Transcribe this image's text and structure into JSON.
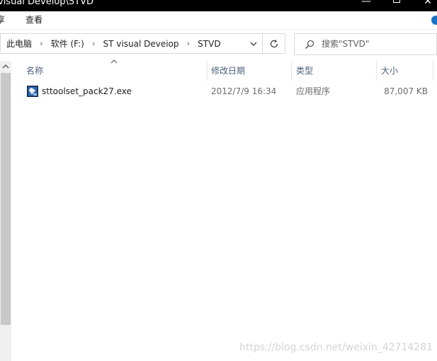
{
  "window": {
    "title": "visual Develop\\STVD",
    "controls": {
      "minimize_icon": "minimize-icon",
      "maximize_icon": "maximize-icon",
      "close_icon": "close-icon"
    }
  },
  "ribbon": {
    "tabs": [
      {
        "label": "享"
      },
      {
        "label": "查看"
      }
    ],
    "help_icon": "help-icon"
  },
  "address": {
    "crumbs": [
      "此电脑",
      "软件 (F:)",
      "ST visual Deveiop",
      "STVD"
    ],
    "separator_icon": "chevron-right-icon",
    "dropdown_icon": "chevron-down-icon",
    "refresh_icon": "refresh-icon"
  },
  "search": {
    "placeholder": "搜索\"STVD\"",
    "icon": "search-icon"
  },
  "columns": [
    {
      "label": "名称"
    },
    {
      "label": "修改日期"
    },
    {
      "label": "类型"
    },
    {
      "label": "大小"
    }
  ],
  "files": [
    {
      "name": "sttoolset_pack27.exe",
      "modified": "2012/7/9 16:34",
      "type": "应用程序",
      "size": "87,007 KB",
      "icon": "exe-installer-icon"
    }
  ],
  "watermark": "https://blog.csdn.net/weixin_42714281",
  "colors": {
    "titlebar_bg": "#000000",
    "header_text": "#4c607a",
    "scroll_thumb": "#c8c8c8",
    "help_accent": "#1a73c8"
  }
}
